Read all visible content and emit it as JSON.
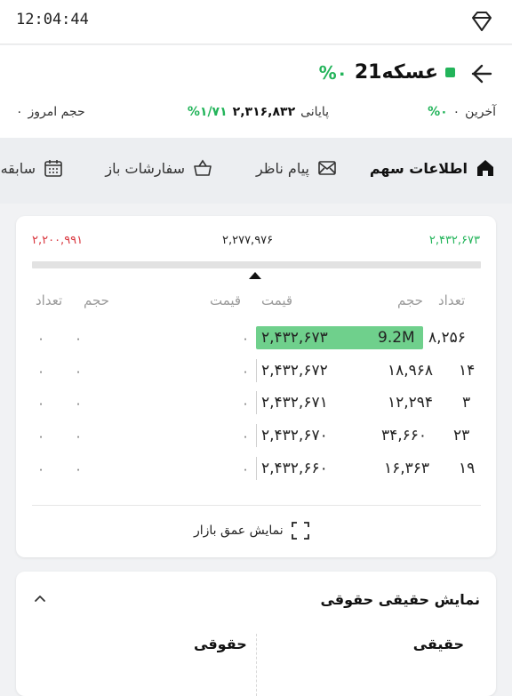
{
  "status_bar": {
    "time": "12:04:44",
    "icon": "gem-icon"
  },
  "header": {
    "symbol": "عسکه21",
    "status_color": "#23b45a",
    "change_pct": "%۰",
    "last_label": "آخرین",
    "last_value": "۰",
    "last_pct": "%۰",
    "close_label": "پایانی",
    "close_value": "۲,۳۱۶,۸۳۲",
    "close_pct": "%۱/۷۱",
    "volume_label": "حجم امروز",
    "volume_value": "۰"
  },
  "tabs": [
    {
      "label": "اطلاعات سهم",
      "icon": "home-icon",
      "active": true
    },
    {
      "label": "پیام ناظر",
      "icon": "mail-icon",
      "active": false
    },
    {
      "label": "سفارشات باز",
      "icon": "basket-icon",
      "active": false
    },
    {
      "label": "سابقه",
      "icon": "calendar-icon",
      "active": false
    }
  ],
  "orderbook": {
    "range_high": "۲,۴۳۲,۶۷۳",
    "range_mid": "۲,۲۷۷,۹۷۶",
    "range_low": "۲,۲۰۰,۹۹۱",
    "colors": {
      "high": "#23b45a",
      "low": "#d9363e",
      "highlight": "#6fd08c"
    },
    "buy_headers": {
      "count": "تعداد",
      "volume": "حجم",
      "price": "قیمت"
    },
    "sell_headers": {
      "count": "تعداد",
      "volume": "حجم",
      "price": "قیمت"
    },
    "buy_rows": [
      {
        "count": "۸,۲۵۶",
        "volume": "9.2M",
        "price": "۲,۴۳۲,۶۷۳"
      },
      {
        "count": "۱۴",
        "volume": "۱۸,۹۶۸",
        "price": "۲,۴۳۲,۶۷۲"
      },
      {
        "count": "۳",
        "volume": "۱۲,۲۹۴",
        "price": "۲,۴۳۲,۶۷۱"
      },
      {
        "count": "۲۳",
        "volume": "۳۴,۶۶۰",
        "price": "۲,۴۳۲,۶۷۰"
      },
      {
        "count": "۱۹",
        "volume": "۱۶,۳۶۳",
        "price": "۲,۴۳۲,۶۶۰"
      }
    ],
    "sell_rows": [
      {
        "count": "۰",
        "volume": "۰",
        "price": "۰"
      },
      {
        "count": "۰",
        "volume": "۰",
        "price": "۰"
      },
      {
        "count": "۰",
        "volume": "۰",
        "price": "۰"
      },
      {
        "count": "۰",
        "volume": "۰",
        "price": "۰"
      },
      {
        "count": "۰",
        "volume": "۰",
        "price": "۰"
      }
    ],
    "depth_button": "نمایش عمق بازار"
  },
  "legal_card": {
    "title": "نمایش حقیقی حقوقی",
    "col_real": "حقیقی",
    "col_legal": "حقوقی"
  }
}
